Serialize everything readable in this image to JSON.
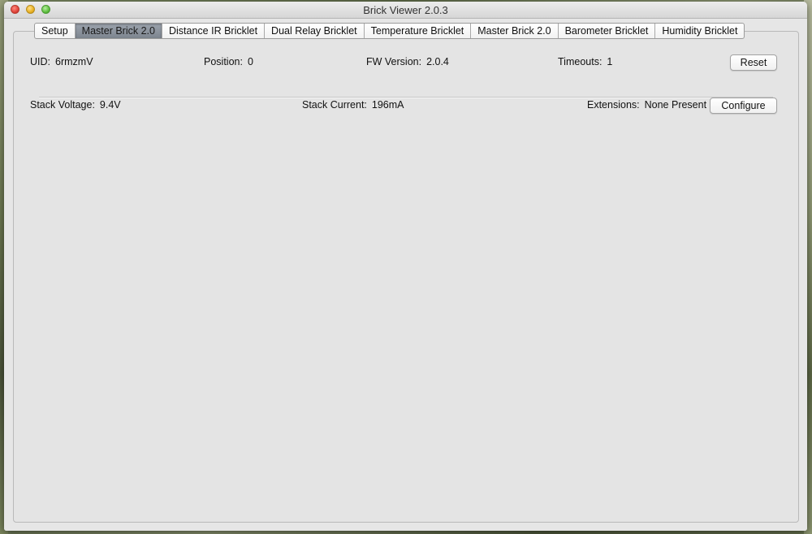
{
  "window": {
    "title": "Brick Viewer 2.0.3"
  },
  "tabs": [
    {
      "label": "Setup",
      "active": false
    },
    {
      "label": "Master Brick 2.0",
      "active": true
    },
    {
      "label": "Distance IR Bricklet",
      "active": false
    },
    {
      "label": "Dual Relay Bricklet",
      "active": false
    },
    {
      "label": "Temperature Bricklet",
      "active": false
    },
    {
      "label": "Master Brick 2.0",
      "active": false
    },
    {
      "label": "Barometer Bricklet",
      "active": false
    },
    {
      "label": "Humidity Bricklet",
      "active": false
    }
  ],
  "info": {
    "uid_label": "UID:",
    "uid_value": "6rmzmV",
    "position_label": "Position:",
    "position_value": "0",
    "fw_label": "FW Version:",
    "fw_value": "2.0.4",
    "timeouts_label": "Timeouts:",
    "timeouts_value": "1",
    "reset_label": "Reset"
  },
  "stack": {
    "voltage_label": "Stack Voltage:",
    "voltage_value": "9.4V",
    "current_label": "Stack Current:",
    "current_value": "196mA",
    "extensions_label": "Extensions:",
    "extensions_value": "None Present",
    "configure_label": "Configure"
  }
}
